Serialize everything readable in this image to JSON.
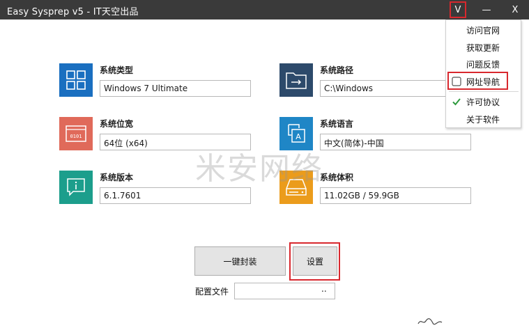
{
  "window": {
    "title": "Easy Sysprep v5 - IT天空出品",
    "menu_glyph": "V",
    "minimize_glyph": "—",
    "close_glyph": "X"
  },
  "cards": {
    "os_type": {
      "label": "系统类型",
      "value": "Windows 7 Ultimate",
      "color": "#1a6fc0",
      "icon": "windows-tiles-icon"
    },
    "os_path": {
      "label": "系统路径",
      "value": "C:\\Windows",
      "color": "#2d4a6b",
      "icon": "folder-arrow-icon"
    },
    "os_bits": {
      "label": "系统位宽",
      "value": "64位 (x64)",
      "color": "#e06a5a",
      "icon": "binary-window-icon"
    },
    "os_lang": {
      "label": "系统语言",
      "value": "中文(简体)-中国",
      "color": "#1f86c6",
      "icon": "language-a-icon"
    },
    "os_ver": {
      "label": "系统版本",
      "value": "6.1.7601",
      "color": "#1c9e8c",
      "icon": "info-bubble-icon"
    },
    "os_size": {
      "label": "系统体积",
      "value": "11.02GB / 59.9GB",
      "color": "#eb9c1c",
      "icon": "hard-drive-icon"
    }
  },
  "watermark": "米安网络",
  "buttons": {
    "seal": "一键封装",
    "settings": "设置"
  },
  "config": {
    "label": "配置文件",
    "value": "",
    "browse": ".."
  },
  "menu": {
    "items": [
      {
        "label": "访问官网",
        "checkbox": "none"
      },
      {
        "label": "获取更新",
        "checkbox": "none"
      },
      {
        "label": "问题反馈",
        "checkbox": "none"
      },
      {
        "label": "网址导航",
        "checkbox": "unchecked"
      },
      {
        "label": "许可协议",
        "checkbox": "checked"
      },
      {
        "label": "关于软件",
        "checkbox": "none"
      }
    ]
  },
  "colors": {
    "titlebar": "#3a3a3a",
    "highlight": "#d8282e",
    "check": "#2e9a3e"
  }
}
